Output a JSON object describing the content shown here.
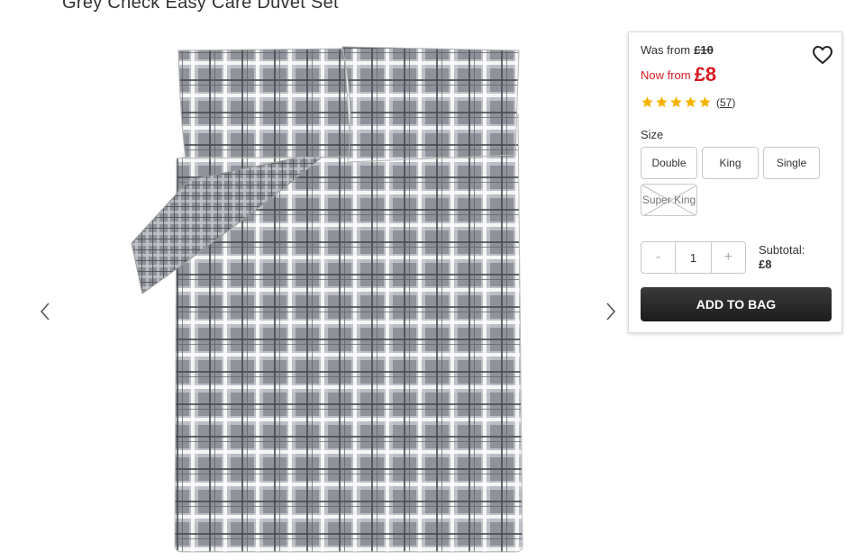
{
  "product": {
    "title": "Grey Check Easy Care Duvet Set"
  },
  "pricing": {
    "was_label": "Was from",
    "was_price": "£10",
    "now_label": "Now from",
    "now_price": "£8"
  },
  "rating": {
    "stars": 5,
    "count_open": "(",
    "count": "57",
    "count_close": ")",
    "star_color": "#f5b301"
  },
  "size": {
    "label": "Size",
    "options": [
      "Double",
      "King",
      "Single",
      "Super King"
    ],
    "out_of_stock": "Super King"
  },
  "quantity": {
    "minus": "-",
    "value": "1",
    "plus": "+"
  },
  "subtotal": {
    "label": "Subtotal:",
    "value": "£8"
  },
  "cta": {
    "add_to_bag": "ADD TO BAG"
  },
  "colors": {
    "sale_red": "#d71921",
    "button_dark": "#2a2a2a"
  },
  "icons": {
    "prev": "chevron-left-icon",
    "next": "chevron-right-icon",
    "wishlist": "heart-icon"
  }
}
